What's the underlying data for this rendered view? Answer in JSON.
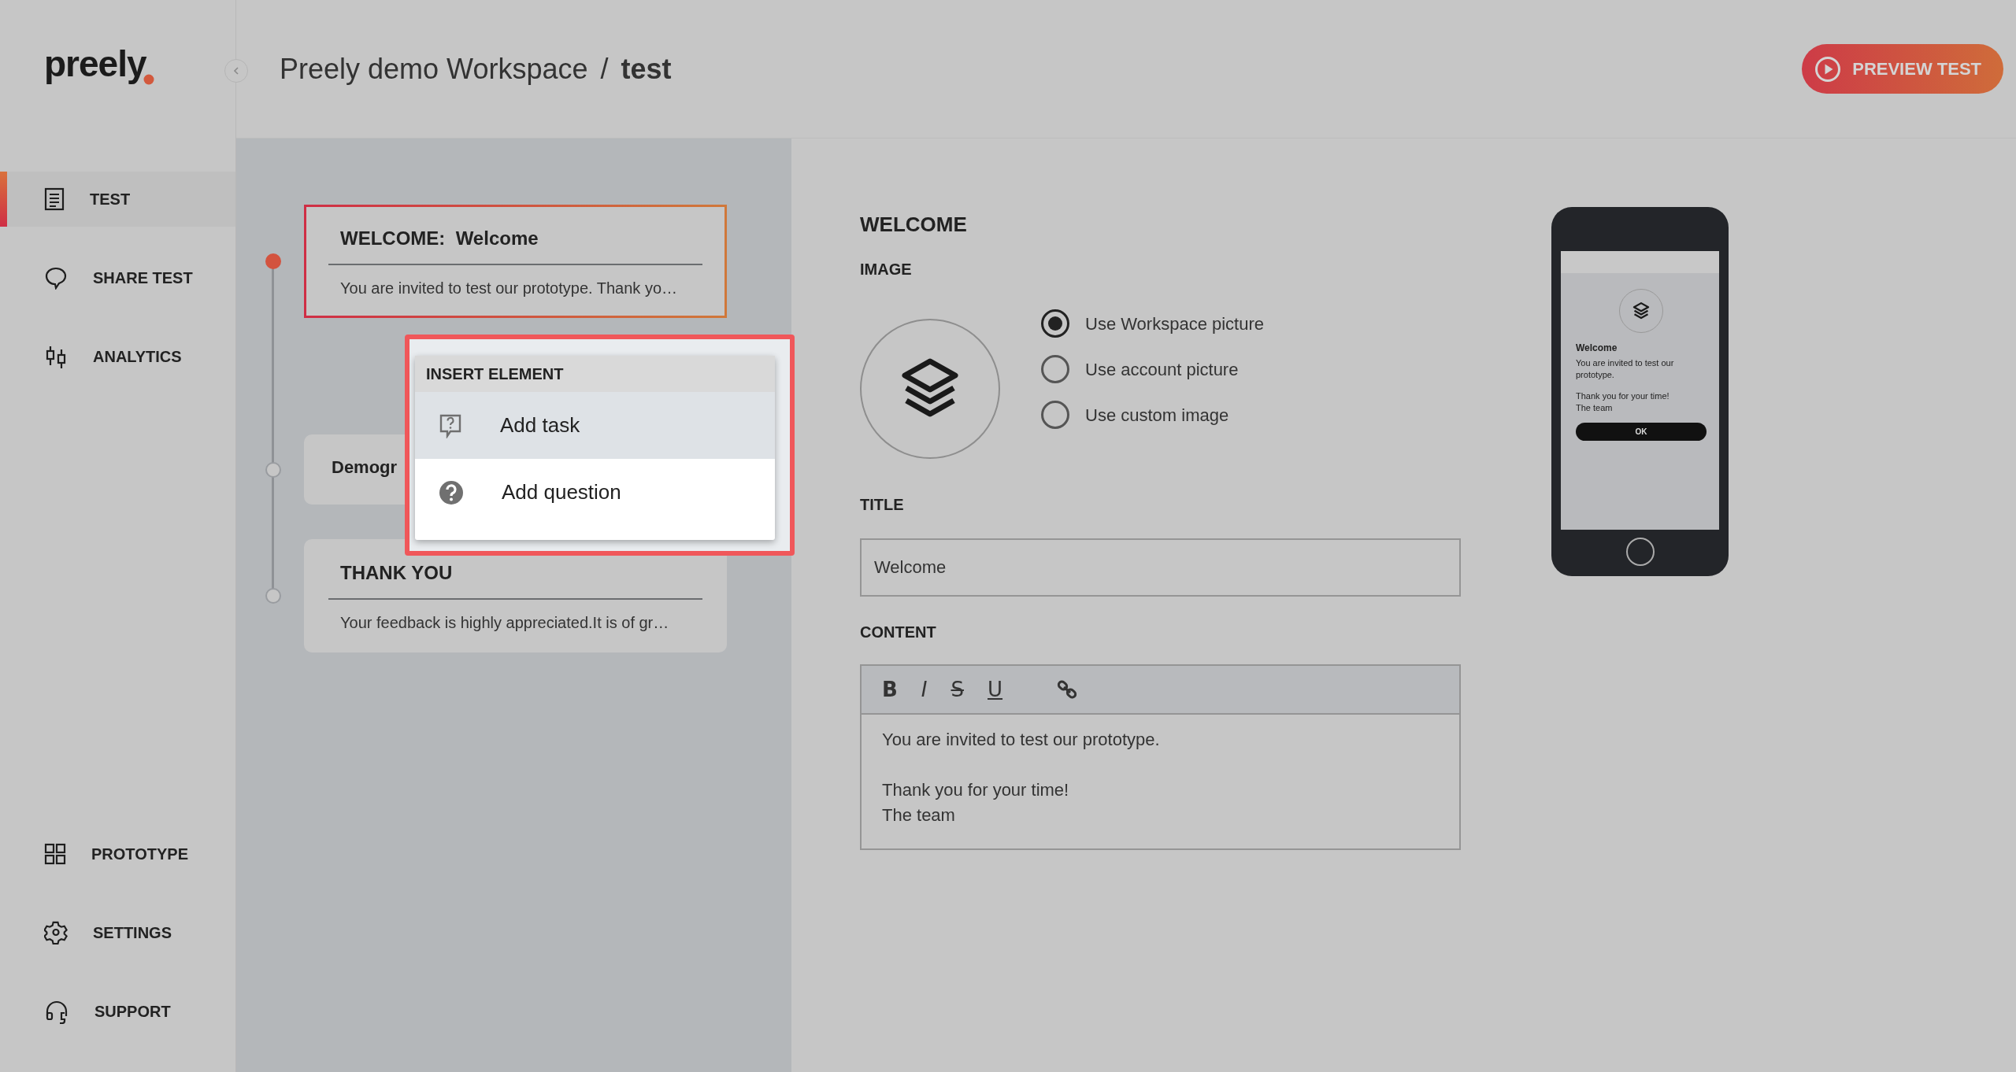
{
  "sidebar": {
    "logo": "preely",
    "top_items": [
      {
        "label": "TEST",
        "selected": true
      },
      {
        "label": "SHARE TEST",
        "selected": false
      },
      {
        "label": "ANALYTICS",
        "selected": false
      }
    ],
    "bottom_items": [
      {
        "label": "PROTOTYPE",
        "selected": false
      },
      {
        "label": "SETTINGS",
        "selected": false
      },
      {
        "label": "SUPPORT",
        "selected": false
      }
    ]
  },
  "header": {
    "workspace": "Preely demo Workspace",
    "separator": "/",
    "test": "test",
    "preview_button": "PREVIEW TEST"
  },
  "elements": [
    {
      "kind": "welcome",
      "prefix": "WELCOME:",
      "title": "Welcome",
      "text": "You are invited to test our prototype. Thank yo…",
      "selected": true
    },
    {
      "kind": "group",
      "title": "Demogr",
      "selected": false
    },
    {
      "kind": "thankyou",
      "title": "THANK YOU",
      "text": "Your feedback is highly appreciated.It is of gr…",
      "selected": false
    }
  ],
  "insert_menu": {
    "title": "INSERT ELEMENT",
    "items": [
      {
        "label": "Add task",
        "selected": true
      },
      {
        "label": "Add question",
        "selected": false
      }
    ]
  },
  "editor": {
    "heading": "WELCOME",
    "image_label": "IMAGE",
    "image_options": [
      {
        "label": "Use Workspace picture",
        "selected": true
      },
      {
        "label": "Use account picture",
        "selected": false
      },
      {
        "label": "Use custom image",
        "selected": false
      }
    ],
    "title_label": "TITLE",
    "title_value": "Welcome",
    "content_label": "CONTENT",
    "toolbar": [
      {
        "label": "B",
        "kind": "bold"
      },
      {
        "label": "I",
        "kind": "italic"
      },
      {
        "label": "S",
        "kind": "strike"
      },
      {
        "label": "U",
        "kind": "underline"
      }
    ],
    "content": [
      [
        "You are invited to test our prototype."
      ],
      [
        "Thank you for your time!",
        "The team"
      ]
    ]
  },
  "phone_preview": {
    "title": "Welcome",
    "text": "You are invited to test our prototype.",
    "lines": [
      "Thank you for your time!",
      "The team"
    ],
    "button": "OK"
  }
}
